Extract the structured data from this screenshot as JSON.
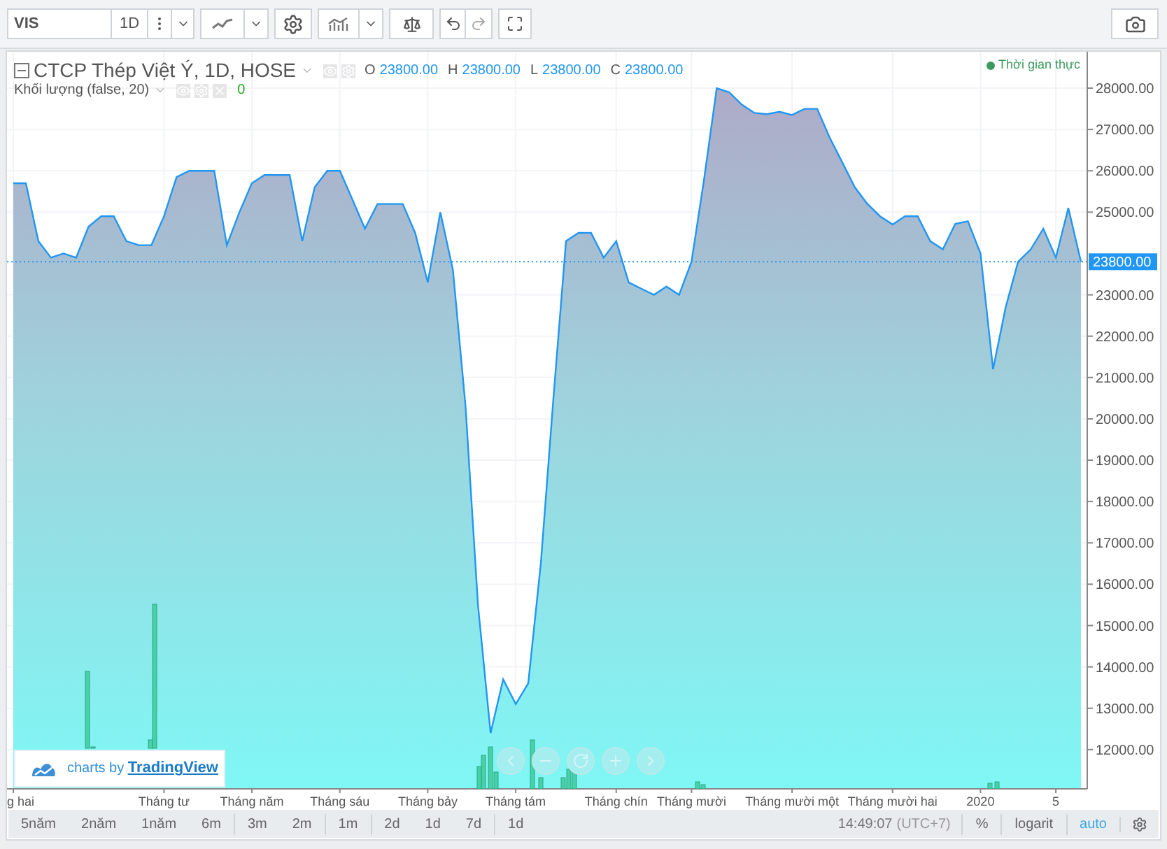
{
  "toolbar": {
    "symbol": "VIS",
    "interval": "1D"
  },
  "legend": {
    "title": "CTCP Thép Việt Ý, 1D, HOSE",
    "ohlc": [
      {
        "label": "O",
        "value": "23800.00"
      },
      {
        "label": "H",
        "value": "23800.00"
      },
      {
        "label": "L",
        "value": "23800.00"
      },
      {
        "label": "C",
        "value": "23800.00"
      }
    ]
  },
  "volume_legend": {
    "title": "Khối lượng (false, 20)",
    "value": "0"
  },
  "realtime": "Thời gian thực",
  "chart": {
    "chart_data": {
      "type": "area",
      "grid": true,
      "ref_lines": [
        {
          "axis": "y",
          "value": 23800,
          "label": "23800.00",
          "color": "#2196f3"
        }
      ],
      "categories": [
        "g hai",
        null,
        null,
        null,
        null,
        null,
        null,
        null,
        null,
        null,
        null,
        null,
        "Tháng tư",
        null,
        null,
        null,
        null,
        null,
        null,
        "Tháng năm",
        null,
        null,
        null,
        null,
        null,
        null,
        "Tháng sáu",
        null,
        null,
        null,
        null,
        null,
        null,
        "Tháng bảy",
        null,
        null,
        null,
        null,
        null,
        null,
        "Tháng tám",
        null,
        null,
        null,
        null,
        null,
        null,
        null,
        "Tháng chín",
        null,
        null,
        null,
        null,
        null,
        "Tháng mười",
        null,
        null,
        null,
        null,
        null,
        null,
        null,
        "Tháng mười một",
        null,
        null,
        null,
        null,
        null,
        null,
        null,
        "Tháng mười hai",
        null,
        null,
        null,
        null,
        null,
        null,
        "2020",
        null,
        null,
        null,
        null,
        null,
        "5",
        null,
        null
      ],
      "series": [
        {
          "color": "#2196f3",
          "values": [
            25700,
            25700,
            24300,
            23900,
            24000,
            23900,
            24650,
            24900,
            24900,
            24300,
            24200,
            24200,
            24900,
            25850,
            26000,
            26000,
            26000,
            24200,
            25000,
            25700,
            25900,
            25900,
            25900,
            24300,
            25600,
            26000,
            26000,
            25300,
            24600,
            25200,
            25200,
            25200,
            24500,
            23300,
            25000,
            23600,
            20300,
            15500,
            12400,
            13700,
            13100,
            13600,
            16500,
            20500,
            24300,
            24500,
            24500,
            23900,
            24300,
            23300,
            23150,
            23000,
            23200,
            23000,
            23800,
            25800,
            28000,
            27900,
            27600,
            27400,
            27370,
            27430,
            27350,
            27500,
            27500,
            26800,
            26200,
            25600,
            25200,
            24900,
            24700,
            24900,
            24900,
            24300,
            24100,
            24720,
            24780,
            24000,
            21200,
            22700,
            23800,
            24100,
            24600,
            23900,
            25100,
            23800
          ]
        }
      ],
      "ylim": [
        11050,
        28880
      ],
      "yticks": [
        {
          "value": 12000,
          "label": "12000.00"
        },
        {
          "value": 13000,
          "label": "13000.00"
        },
        {
          "value": 14000,
          "label": "14000.00"
        },
        {
          "value": 15000,
          "label": "15000.00"
        },
        {
          "value": 16000,
          "label": "16000.00"
        },
        {
          "value": 17000,
          "label": "17000.00"
        },
        {
          "value": 18000,
          "label": "18000.00"
        },
        {
          "value": 19000,
          "label": "19000.00"
        },
        {
          "value": 20000,
          "label": "20000.00"
        },
        {
          "value": 21000,
          "label": "21000.00"
        },
        {
          "value": 22000,
          "label": "22000.00"
        },
        {
          "value": 23000,
          "label": "23000.00"
        },
        {
          "value": 25000,
          "label": "25000.00"
        },
        {
          "value": 26000,
          "label": "26000.00"
        },
        {
          "value": 27000,
          "label": "27000.00"
        },
        {
          "value": 28000,
          "label": "28000.00"
        }
      ]
    }
  },
  "branding": {
    "prefix": "charts by",
    "link": "TradingView"
  },
  "range_groups": [
    [
      "5năm",
      "2năm",
      "1năm",
      "6m"
    ],
    [
      "3m",
      "2m"
    ],
    [
      "1m"
    ],
    [
      "2d",
      "1d",
      "7d"
    ],
    [
      "1d"
    ]
  ],
  "status": {
    "time": "14:49:07",
    "timezone": "(UTC+7)",
    "scale_options": [
      {
        "label": "%",
        "selected": false
      },
      {
        "label": "logarit",
        "selected": false
      },
      {
        "label": "auto",
        "selected": true
      }
    ]
  }
}
